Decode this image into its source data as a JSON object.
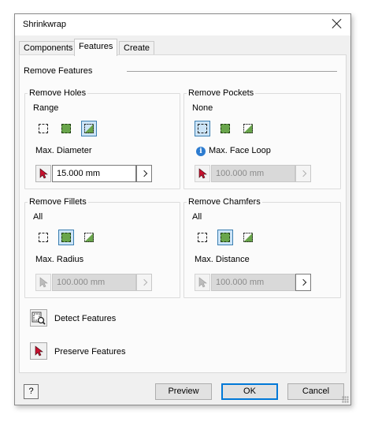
{
  "window": {
    "title": "Shrinkwrap"
  },
  "tabs": [
    {
      "label": "Components",
      "active": false
    },
    {
      "label": "Features",
      "active": true
    },
    {
      "label": "Create",
      "active": false
    }
  ],
  "section": {
    "label": "Remove Features"
  },
  "groups": {
    "holes": {
      "title": "Remove Holes",
      "mode": "Range",
      "param_label": "Max. Diameter",
      "value": "15.000 mm",
      "enabled": true,
      "selected_option": 2
    },
    "pockets": {
      "title": "Remove Pockets",
      "mode": "None",
      "param_label": "Max. Face Loop",
      "value": "100.000 mm",
      "enabled": false,
      "selected_option": 0
    },
    "fillets": {
      "title": "Remove Fillets",
      "mode": "All",
      "param_label": "Max. Radius",
      "value": "100.000 mm",
      "enabled": false,
      "selected_option": 1
    },
    "chamfers": {
      "title": "Remove Chamfers",
      "mode": "All",
      "param_label": "Max. Distance",
      "value": "100.000 mm",
      "enabled": false,
      "selected_option": 1
    }
  },
  "actions": {
    "detect": "Detect Features",
    "preserve": "Preserve Features"
  },
  "footer": {
    "help": "?",
    "preview": "Preview",
    "ok": "OK",
    "cancel": "Cancel"
  },
  "colors": {
    "accent": "#0078d7",
    "feature_fill": "#69a54b",
    "cursor_red": "#c8102e",
    "selected_bg": "#cce4f7"
  }
}
